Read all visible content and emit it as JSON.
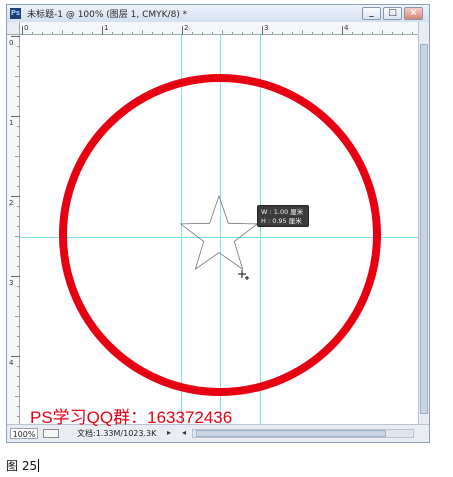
{
  "window": {
    "app_icon_text": "Ps",
    "title": "未标题-1 @ 100% (图层 1, CMYK/8) *",
    "buttons": {
      "minimize": "_",
      "maximize": "□",
      "close": "×"
    }
  },
  "rulers": {
    "horizontal_labels": [
      "0",
      "1",
      "2",
      "3",
      "4"
    ],
    "vertical_labels": [
      "0",
      "1",
      "2",
      "3",
      "4"
    ]
  },
  "canvas": {
    "circle_color": "#e60012",
    "guide_color": "#7fe0e6",
    "shape": "star"
  },
  "tooltip": {
    "width_line": "W : 1.00 厘米",
    "height_line": "H : 0.95 厘米"
  },
  "statusbar": {
    "zoom": "100%",
    "doc_info": "文档:1.33M/1023.3K",
    "arrow_right": "▸",
    "arrow_left": "◂"
  },
  "watermark": "PS学习QQ群：163372436",
  "caption": "图 25"
}
